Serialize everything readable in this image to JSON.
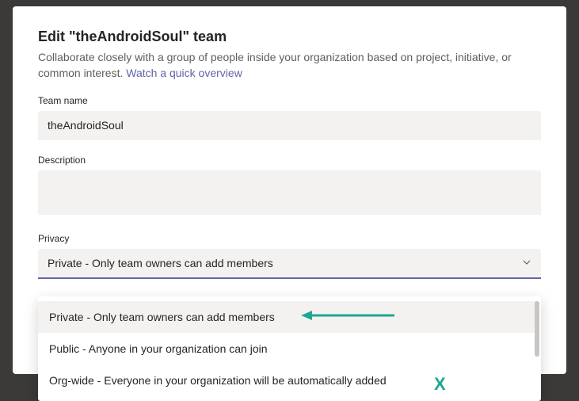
{
  "modal": {
    "title": "Edit \"theAndroidSoul\" team",
    "description_pre": "Collaborate closely with a group of people inside your organization based on project, initiative, or common interest. ",
    "overview_link": "Watch a quick overview"
  },
  "fields": {
    "team_name_label": "Team name",
    "team_name_value": "theAndroidSoul",
    "description_label": "Description",
    "description_value": "",
    "privacy_label": "Privacy",
    "privacy_selected": "Private - Only team owners can add members"
  },
  "dropdown": {
    "options": [
      "Private - Only team owners can add members",
      "Public - Anyone in your organization can join",
      "Org-wide - Everyone in your organization will be automatically added"
    ]
  },
  "annotations": {
    "arrow_color": "#1fa693",
    "x_mark": "X"
  }
}
